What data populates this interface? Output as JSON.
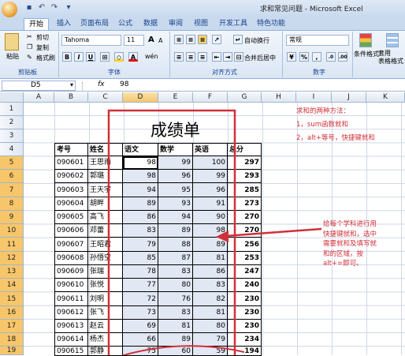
{
  "window": {
    "title": "求和常见问题 - Microsoft Excel"
  },
  "tabs": [
    "开始",
    "插入",
    "页面布局",
    "公式",
    "数据",
    "审阅",
    "视图",
    "开发工具",
    "特色功能"
  ],
  "ribbon": {
    "clipboard": {
      "paste": "粘贴",
      "cut": "剪切",
      "copy": "复制",
      "format_painter": "格式刷",
      "label": "剪贴板"
    },
    "font": {
      "name": "Tahoma",
      "size": "11",
      "grow": "A",
      "shrink": "A",
      "bold": "B",
      "italic": "I",
      "underline": "U",
      "label": "字体",
      "font_color_letter": "A",
      "phonetic": "wén"
    },
    "alignment": {
      "wrap": "自动换行",
      "merge": "合并后居中",
      "label": "对齐方式"
    },
    "number": {
      "format": "常规",
      "label": "数字",
      "percent": "%",
      "comma": ",",
      "currency": "¥"
    },
    "styles": {
      "conditional": "条件格式",
      "table": "套用\n表格格式"
    }
  },
  "formula_bar": {
    "name_box": "D5",
    "fx": "fx",
    "content": "98"
  },
  "columns": [
    "A",
    "B",
    "C",
    "D",
    "E",
    "F",
    "G",
    "H",
    "I",
    "J",
    "K"
  ],
  "rows": [
    "1",
    "2",
    "3",
    "4",
    "5",
    "6",
    "7",
    "8",
    "9",
    "10",
    "11",
    "12",
    "13",
    "14",
    "15",
    "16",
    "17",
    "18",
    "19"
  ],
  "sheet": {
    "title": "成绩单",
    "headers": [
      "考号",
      "姓名",
      "语文",
      "数学",
      "英语",
      "总分"
    ],
    "records": [
      [
        "090601",
        "王思雨",
        "98",
        "99",
        "100",
        "297"
      ],
      [
        "090602",
        "郭璐",
        "98",
        "96",
        "99",
        "293"
      ],
      [
        "090603",
        "王天宇",
        "94",
        "95",
        "96",
        "285"
      ],
      [
        "090604",
        "胡畔",
        "89",
        "93",
        "91",
        "273"
      ],
      [
        "090605",
        "高飞",
        "86",
        "94",
        "90",
        "270"
      ],
      [
        "090606",
        "邓蕾",
        "83",
        "89",
        "98",
        "270"
      ],
      [
        "090607",
        "王昭君",
        "79",
        "88",
        "89",
        "256"
      ],
      [
        "090608",
        "孙悟空",
        "85",
        "87",
        "81",
        "253"
      ],
      [
        "090609",
        "张瑞",
        "78",
        "83",
        "86",
        "247"
      ],
      [
        "090610",
        "张悦",
        "77",
        "80",
        "83",
        "240"
      ],
      [
        "090611",
        "刘明",
        "72",
        "76",
        "82",
        "230"
      ],
      [
        "090612",
        "张飞",
        "73",
        "83",
        "81",
        "230"
      ],
      [
        "090613",
        "赵云",
        "69",
        "81",
        "80",
        "230"
      ],
      [
        "090614",
        "杨杰",
        "66",
        "89",
        "79",
        "234"
      ],
      [
        "090615",
        "郭静",
        "75",
        "60",
        "59",
        "194"
      ]
    ]
  },
  "notes": {
    "methods_title": "求和的两种方法：",
    "method1": "1，sum函数就和",
    "method2": "2，alt+等号，快捷键就和",
    "annotation": [
      "给每个学科进行用",
      "快捷键就和，选中",
      "需要就和及填写就",
      "和的区域，按",
      "alt+=即可。"
    ]
  },
  "colors": {
    "annotation_red": "#d0303a",
    "ribbon_blue": "#15428b"
  }
}
